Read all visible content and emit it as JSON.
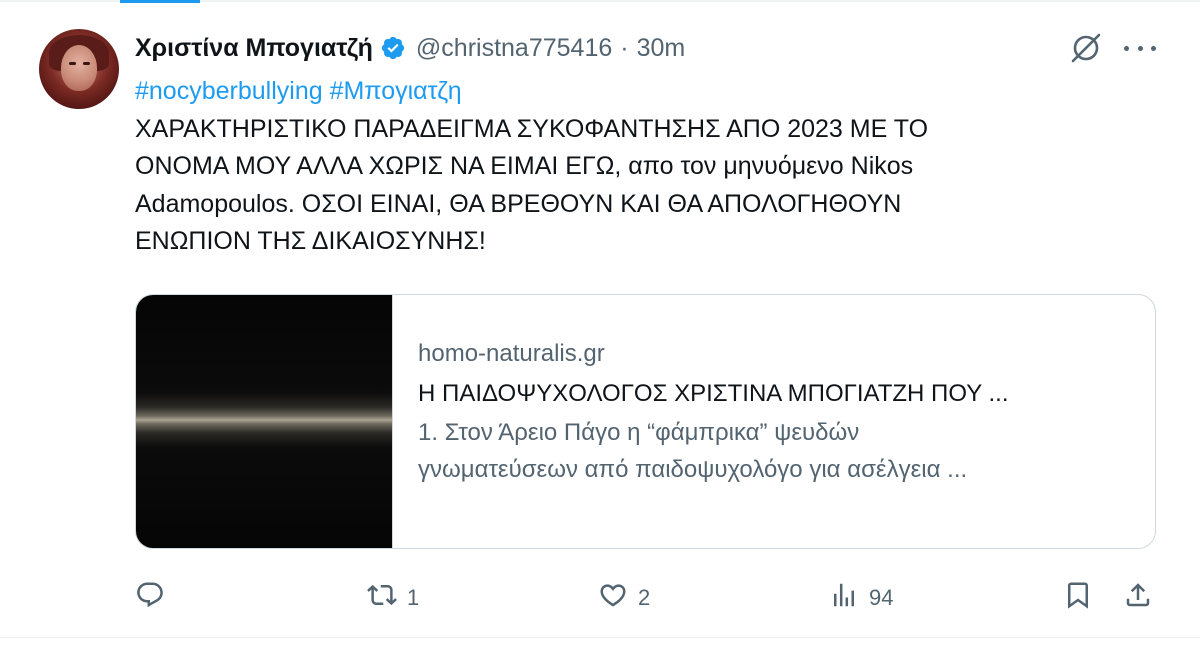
{
  "tweet": {
    "author_name": "Χριστίνα Μπογιατζή",
    "handle": "@christna775416",
    "separator": "·",
    "time": "30m",
    "verified": true,
    "hashtags": [
      "#nocyberbullying",
      "#Μπογιατζη"
    ],
    "body_lines": [
      "ΧΑΡΑΚΤΗΡΙΣΤΙΚΟ ΠΑΡΑΔΕΙΓΜΑ ΣΥΚΟΦΑΝΤΗΣΗΣ ΑΠΟ 2023 ΜΕ ΤΟ",
      "ΟΝΟΜΑ ΜΟΥ ΑΛΛΑ ΧΩΡΙΣ ΝΑ ΕΙΜΑΙ ΕΓΩ, απο τον μηνυόμενο Nikos",
      "Adamopoulos. ΟΣΟΙ ΕΙΝΑΙ, ΘΑ ΒΡΕΘΟΥΝ ΚΑΙ ΘΑ ΑΠΟΛΟΓΗΘΟΥΝ",
      "ΕΝΩΠΙΟΝ ΤΗΣ ΔΙΚΑΙΟΣΥΝΗΣ!"
    ]
  },
  "card": {
    "domain": "homo-naturalis.gr",
    "title": "Η ΠΑΙΔΟΨΥΧΟΛΟΓΟΣ ΧΡΙΣΤΙΝΑ ΜΠΟΓΙΑΤΖΗ ΠΟΥ ...",
    "description_lines": [
      "1. Στον Άρειο Πάγο η “φάμπρικα” ψευδών",
      "γνωματεύσεων από παιδοψυχολόγο για ασέλγεια ..."
    ]
  },
  "actions": {
    "retweet_count": "1",
    "like_count": "2",
    "views_count": "94"
  },
  "icons": {
    "verified": "verified-badge-icon",
    "grok": "grok-icon",
    "more": "more-icon",
    "reply": "reply-icon",
    "retweet": "retweet-icon",
    "like": "heart-icon",
    "views": "views-icon",
    "bookmark": "bookmark-icon",
    "share": "share-icon"
  },
  "colors": {
    "accent": "#1d9bf0",
    "text": "#0f1419",
    "secondary": "#536471",
    "border": "#cfd9de"
  }
}
